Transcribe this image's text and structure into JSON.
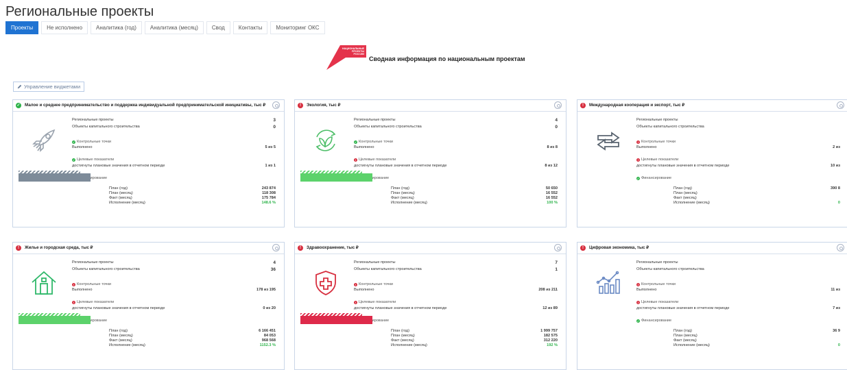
{
  "page": {
    "title": "Региональные проекты"
  },
  "tabs": [
    {
      "label": "Проекты"
    },
    {
      "label": "Не исполнено"
    },
    {
      "label": "Аналитика (год)"
    },
    {
      "label": "Аналитика (месяц)"
    },
    {
      "label": "Свод"
    },
    {
      "label": "Контакты"
    },
    {
      "label": "Мониторинг ОКС"
    }
  ],
  "header": {
    "logo_text": [
      "НАЦИОНАЛЬНЫЕ",
      "ПРОЕКТЫ",
      "РОССИИ"
    ],
    "title": "Сводная информация по национальным проектам"
  },
  "manage_button": {
    "icon": "pencil-icon",
    "label": "Управление виджетами"
  },
  "labels": {
    "regional_projects": "Региональные проекты",
    "capital_objects": "Объекты капитального строительства",
    "control_points": "Контрольные точки",
    "done": "Выполнено",
    "target_indicators": "Целевые показатели",
    "targets_reached": "достигнуты плановые значения в отчетном периоде",
    "financing": "Финансирование",
    "plan_year": "План (год)",
    "plan_month": "План (месяц)",
    "fact_month": "Факт (месяц)",
    "exec_month": "Исполнение (месяц)"
  },
  "colors": {
    "ok": "#2db34a",
    "bad": "#d72f3f",
    "accent": "#1f73d2",
    "gray_bar": "#7d8b99",
    "green_bar": "#5cd26b",
    "red_bar": "#de2a4a"
  },
  "cards": [
    {
      "title": "Малое и среднее предпринимательство и поддержка индивидуальной предпринимательской инициативы, тыс ₽",
      "status": "ok",
      "icon": "rocket-icon",
      "icon_color": "#9aa3ae",
      "regional_projects": "3",
      "capital_objects": "0",
      "control_status": "ok",
      "control_value": "5 из 5",
      "target_status": "ok",
      "target_value": "1 из 1",
      "fin_status": "ok",
      "bar": "gray",
      "bar_fill": 1.0,
      "plan_year": "243 874",
      "plan_month": "118 308",
      "fact_month": "175 784",
      "exec_month": "148.6 %"
    },
    {
      "title": "Экология, тыс ₽",
      "status": "bad",
      "icon": "leaf-recycle-icon",
      "icon_color": "#4fbf6a",
      "regional_projects": "4",
      "capital_objects": "0",
      "control_status": "ok",
      "control_value": "8 из 8",
      "target_status": "bad",
      "target_value": "8 из 12",
      "fin_status": "ok",
      "bar": "green",
      "bar_fill": 1.0,
      "plan_year": "50 650",
      "plan_month": "16 552",
      "fact_month": "16 552",
      "exec_month": "100 %"
    },
    {
      "title": "Международная кооперация и экспорт, тыс ₽",
      "status": "bad",
      "icon": "exchange-arrows-icon",
      "icon_color": "#5a6470",
      "regional_projects": "",
      "capital_objects": "",
      "control_status": "bad",
      "control_value": "2 из",
      "target_status": "bad",
      "target_value": "10 из",
      "fin_status": "ok",
      "bar": "none",
      "bar_fill": 0,
      "plan_year": "390 8",
      "plan_month": "",
      "fact_month": "",
      "exec_month": "0"
    },
    {
      "title": "Жилье и городская среда, тыс ₽",
      "status": "bad",
      "icon": "house-icon",
      "icon_color": "#2fb86a",
      "regional_projects": "4",
      "capital_objects": "36",
      "control_status": "bad",
      "control_value": "178 из 195",
      "target_status": "bad",
      "target_value": "0 из 20",
      "fin_status": "ok",
      "bar": "green",
      "bar_fill": 1.0,
      "plan_year": "6 166 451",
      "plan_month": "84 053",
      "fact_month": "968 568",
      "exec_month": "1152.3 %"
    },
    {
      "title": "Здравоохранение, тыс ₽",
      "status": "bad",
      "icon": "medical-shield-icon",
      "icon_color": "#d72f3f",
      "regional_projects": "7",
      "capital_objects": "1",
      "control_status": "bad",
      "control_value": "208 из 211",
      "target_status": "bad",
      "target_value": "12 из 89",
      "fin_status": "bad",
      "bar": "red",
      "bar_fill": 1.0,
      "plan_year": "1 999 757",
      "plan_month": "182 575",
      "fact_month": "312 220",
      "exec_month": "192 %"
    },
    {
      "title": "Цифровая экономика, тыс ₽",
      "status": "bad",
      "icon": "chart-growth-icon",
      "icon_color": "#6b8ac4",
      "regional_projects": "",
      "capital_objects": "",
      "control_status": "bad",
      "control_value": "11 из",
      "target_status": "bad",
      "target_value": "7 из",
      "fin_status": "ok",
      "bar": "none",
      "bar_fill": 0,
      "plan_year": "36 9",
      "plan_month": "",
      "fact_month": "",
      "exec_month": "0"
    }
  ]
}
